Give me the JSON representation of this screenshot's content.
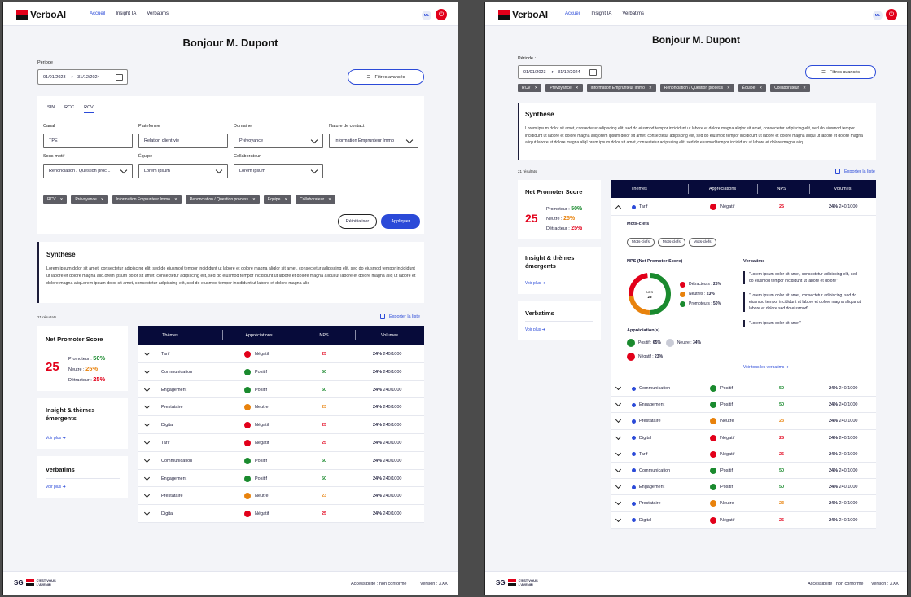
{
  "app": {
    "name": "VerboAI"
  },
  "nav": {
    "items": [
      "Accueil",
      "Insight IA",
      "Verbatims"
    ]
  },
  "user": {
    "initials": "ML"
  },
  "greeting": "Bonjour M. Dupont",
  "period": {
    "label": "Période :",
    "start": "01/01/2023",
    "end": "31/12/2024"
  },
  "filters_button": "Filtres avancés",
  "filter_panel": {
    "tabs": [
      "SIN",
      "RCC",
      "RCV"
    ],
    "fields": [
      {
        "label": "Canal",
        "value": "TPE"
      },
      {
        "label": "Plateforme",
        "value": "Relation client vie"
      },
      {
        "label": "Domaine",
        "value": "Prévoyance"
      },
      {
        "label": "Nature de contact",
        "value": "Information Emprunteur Immo"
      },
      {
        "label": "Sous-motif",
        "value": "Renonciation / Question proc..."
      },
      {
        "label": "Équipe",
        "value": "Lorem ipsum"
      },
      {
        "label": "Collaborateur",
        "value": "Lorem ipsum"
      }
    ],
    "reset": "Réinitialiser",
    "apply": "Appliquer"
  },
  "tags": [
    "RCV",
    "Prévoyance",
    "Information Emprunteur Immo",
    "Renonciation / Question process",
    "Équipe",
    "Collaborateur"
  ],
  "synthese": {
    "title": "Synthèse",
    "text": "Lorem ipsum dolor sit amet, consectetur adipiscing elit, sed do eiusmod tempor incididunt ut labore et dolore magna aliqlor sit amet, consectetur adipiscing elit, sed do eiusmod tempor incididunt ut labore et dolore magna aliq.orem ipsum dolor sit amet, consectetur adipiscing elit, sed do eiusmod tempor incididunt ut labore et dolore magna aliqui ut labore et dolore magna aliq ut labore et dolore magna aliqLorem ipsum dolor sit amet, consectetur adipiscing elit, sed do eiusmod tempor incididunt ut labore et dolore magna aliq"
  },
  "results": "21 résultats",
  "export": "Exporter la liste",
  "nps_card": {
    "title": "Net Promoter Score",
    "score": "25",
    "rows": [
      {
        "label": "Promoteur :",
        "value": "50%",
        "color": "#1a8a2e"
      },
      {
        "label": "Neutre :",
        "value": "25%",
        "color": "#e8820c"
      },
      {
        "label": "Détracteur :",
        "value": "25%",
        "color": "#e2001a"
      }
    ]
  },
  "insight_card": {
    "title": "Insight & thèmes émergents",
    "link": "Voir plus"
  },
  "verbatims_card": {
    "title": "Verbatims",
    "link": "Voir plus"
  },
  "table": {
    "headers": [
      "Thèmes",
      "Appréciations",
      "NPS",
      "Volumes"
    ],
    "rows": [
      {
        "theme": "Tarif",
        "appr": "Négatif",
        "nps": "25",
        "pct": "24%",
        "vol": "240/1000"
      },
      {
        "theme": "Communication",
        "appr": "Positif",
        "nps": "50",
        "pct": "24%",
        "vol": "240/1000"
      },
      {
        "theme": "Engagement",
        "appr": "Positif",
        "nps": "50",
        "pct": "24%",
        "vol": "240/1000"
      },
      {
        "theme": "Prestataire",
        "appr": "Neutre",
        "nps": "23",
        "pct": "24%",
        "vol": "240/1000"
      },
      {
        "theme": "Digital",
        "appr": "Négatif",
        "nps": "25",
        "pct": "24%",
        "vol": "240/1000"
      },
      {
        "theme": "Tarif",
        "appr": "Négatif",
        "nps": "25",
        "pct": "24%",
        "vol": "240/1000"
      },
      {
        "theme": "Communication",
        "appr": "Positif",
        "nps": "50",
        "pct": "24%",
        "vol": "240/1000"
      },
      {
        "theme": "Engagement",
        "appr": "Positif",
        "nps": "50",
        "pct": "24%",
        "vol": "240/1000"
      },
      {
        "theme": "Prestataire",
        "appr": "Neutre",
        "nps": "23",
        "pct": "24%",
        "vol": "240/1000"
      },
      {
        "theme": "Digital",
        "appr": "Négatif",
        "nps": "25",
        "pct": "24%",
        "vol": "240/1000"
      }
    ]
  },
  "detail": {
    "keywords_title": "Mots-clefs",
    "keywords": [
      "Mots-clefs",
      "Mots-clefs",
      "Mots-clefs"
    ],
    "nps_title": "NPS (Net Promoter Score)",
    "donut_label": "NPS",
    "donut_value": "25",
    "nps_legend": [
      {
        "label": "Détracteurs :",
        "value": "25%",
        "color": "#e2001a"
      },
      {
        "label": "Neutres :",
        "value": "23%",
        "color": "#e8820c"
      },
      {
        "label": "Promoteurs :",
        "value": "50%",
        "color": "#1a8a2e"
      }
    ],
    "appr_title": "Appréciation(s)",
    "appr": [
      {
        "label": "Positif :",
        "value": "65%",
        "color": "#1a8a2e"
      },
      {
        "label": "Neutre :",
        "value": "34%",
        "color": "#c9cbd6"
      },
      {
        "label": "Négatif :",
        "value": "23%",
        "color": "#e2001a"
      }
    ],
    "verbatims_title": "Verbatims",
    "quotes": [
      "\"Lorem ipsum dolor sit amet, consectetur adipiscing elit, sed do eiusmod tempor incididunt ut labore et dolore\"",
      "\"Lorem ipsum dolor sit amet, consectetur adipiscing, sed do eiusmod tempor incididunt ut labore et dolore magna aliqua ut labore et dolore sed do eiusmod\"",
      "\"Lorem ipsum dolor sit amet\""
    ],
    "all_verbatims": "Voir tous les verbatims"
  },
  "table2": {
    "rows": [
      {
        "theme": "Tarif",
        "appr": "Négatif",
        "nps": "25",
        "pct": "24%",
        "vol": "240/1000"
      },
      {
        "theme": "Communication",
        "appr": "Positif",
        "nps": "50",
        "pct": "24%",
        "vol": "240/1000"
      },
      {
        "theme": "Engagement",
        "appr": "Positif",
        "nps": "50",
        "pct": "24%",
        "vol": "240/1000"
      },
      {
        "theme": "Prestataire",
        "appr": "Neutre",
        "nps": "23",
        "pct": "24%",
        "vol": "240/1000"
      },
      {
        "theme": "Digital",
        "appr": "Négatif",
        "nps": "25",
        "pct": "24%",
        "vol": "240/1000"
      },
      {
        "theme": "Tarif",
        "appr": "Négatif",
        "nps": "25",
        "pct": "24%",
        "vol": "240/1000"
      },
      {
        "theme": "Communication",
        "appr": "Positif",
        "nps": "50",
        "pct": "24%",
        "vol": "240/1000"
      },
      {
        "theme": "Engagement",
        "appr": "Positif",
        "nps": "50",
        "pct": "24%",
        "vol": "240/1000"
      },
      {
        "theme": "Prestataire",
        "appr": "Neutre",
        "nps": "23",
        "pct": "24%",
        "vol": "240/1000"
      },
      {
        "theme": "Digital",
        "appr": "Négatif",
        "nps": "25",
        "pct": "24%",
        "vol": "240/1000"
      }
    ]
  },
  "footer": {
    "brand": "SG",
    "slogan": "C'EST VOUS L'AVENIR",
    "accessibility": "Accessibilité : non conforme",
    "version": "Version : XXX"
  },
  "colors": {
    "positif": "#1a8a2e",
    "neutre": "#e8820c",
    "negatif": "#e2001a",
    "accent": "#2b4ad8",
    "header_dark": "#070b3a"
  }
}
